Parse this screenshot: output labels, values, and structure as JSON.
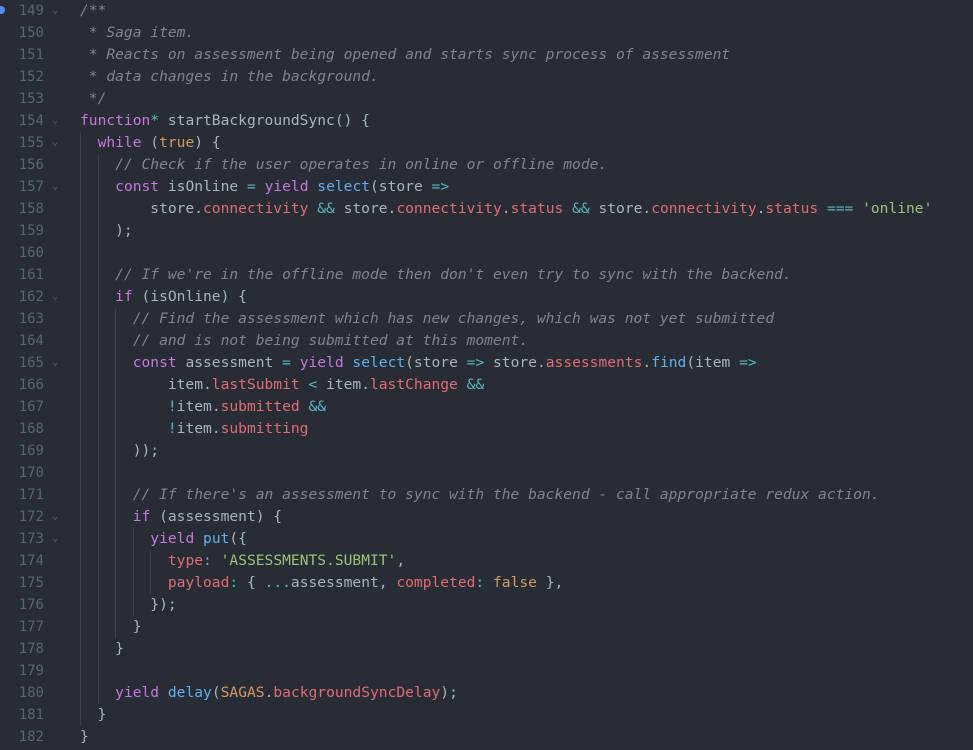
{
  "editor": {
    "breakpoint_line": 149,
    "lines": [
      {
        "n": "149",
        "fold": true,
        "indent": 0,
        "tokens": [
          [
            "c",
            "/**"
          ]
        ]
      },
      {
        "n": "150",
        "fold": false,
        "indent": 0,
        "tokens": [
          [
            "c",
            " * Saga item."
          ]
        ]
      },
      {
        "n": "151",
        "fold": false,
        "indent": 0,
        "tokens": [
          [
            "c",
            " * Reacts on assessment being opened and starts sync process of assessment"
          ]
        ]
      },
      {
        "n": "152",
        "fold": false,
        "indent": 0,
        "tokens": [
          [
            "c",
            " * data changes in the background."
          ]
        ]
      },
      {
        "n": "153",
        "fold": false,
        "indent": 0,
        "tokens": [
          [
            "c",
            " */"
          ]
        ]
      },
      {
        "n": "154",
        "fold": true,
        "indent": 0,
        "tokens": [
          [
            "k",
            "function"
          ],
          [
            "o",
            "*"
          ],
          [
            "p",
            " startBackgroundSync() {"
          ]
        ]
      },
      {
        "n": "155",
        "fold": true,
        "indent": 1,
        "tokens": [
          [
            "p",
            "  "
          ],
          [
            "k",
            "while"
          ],
          [
            "p",
            " ("
          ],
          [
            "n",
            "true"
          ],
          [
            "p",
            ") {"
          ]
        ]
      },
      {
        "n": "156",
        "fold": false,
        "indent": 2,
        "tokens": [
          [
            "p",
            "    "
          ],
          [
            "c",
            "// Check if the user operates in online or offline mode."
          ]
        ]
      },
      {
        "n": "157",
        "fold": true,
        "indent": 2,
        "tokens": [
          [
            "p",
            "    "
          ],
          [
            "k",
            "const"
          ],
          [
            "p",
            " isOnline "
          ],
          [
            "o",
            "="
          ],
          [
            "p",
            " "
          ],
          [
            "k",
            "yield"
          ],
          [
            "p",
            " "
          ],
          [
            "f",
            "select"
          ],
          [
            "p",
            "(store "
          ],
          [
            "o",
            "=>"
          ]
        ]
      },
      {
        "n": "158",
        "fold": false,
        "indent": 2,
        "tokens": [
          [
            "p",
            "        store."
          ],
          [
            "r",
            "connectivity"
          ],
          [
            "p",
            " "
          ],
          [
            "o",
            "&&"
          ],
          [
            "p",
            " store."
          ],
          [
            "r",
            "connectivity"
          ],
          [
            "p",
            "."
          ],
          [
            "r",
            "status"
          ],
          [
            "p",
            " "
          ],
          [
            "o",
            "&&"
          ],
          [
            "p",
            " store."
          ],
          [
            "r",
            "connectivity"
          ],
          [
            "p",
            "."
          ],
          [
            "r",
            "status"
          ],
          [
            "p",
            " "
          ],
          [
            "o",
            "==="
          ],
          [
            "p",
            " "
          ],
          [
            "s",
            "'online'"
          ]
        ]
      },
      {
        "n": "159",
        "fold": false,
        "indent": 2,
        "tokens": [
          [
            "p",
            "    );"
          ]
        ]
      },
      {
        "n": "160",
        "fold": false,
        "indent": 2,
        "tokens": []
      },
      {
        "n": "161",
        "fold": false,
        "indent": 2,
        "tokens": [
          [
            "p",
            "    "
          ],
          [
            "c",
            "// If we're in the offline mode then don't even try to sync with the backend."
          ]
        ]
      },
      {
        "n": "162",
        "fold": true,
        "indent": 2,
        "tokens": [
          [
            "p",
            "    "
          ],
          [
            "k",
            "if"
          ],
          [
            "p",
            " (isOnline) {"
          ]
        ]
      },
      {
        "n": "163",
        "fold": false,
        "indent": 3,
        "tokens": [
          [
            "p",
            "      "
          ],
          [
            "c",
            "// Find the assessment which has new changes, which was not yet submitted"
          ]
        ]
      },
      {
        "n": "164",
        "fold": false,
        "indent": 3,
        "tokens": [
          [
            "p",
            "      "
          ],
          [
            "c",
            "// and is not being submitted at this moment."
          ]
        ]
      },
      {
        "n": "165",
        "fold": true,
        "indent": 3,
        "tokens": [
          [
            "p",
            "      "
          ],
          [
            "k",
            "const"
          ],
          [
            "p",
            " assessment "
          ],
          [
            "o",
            "="
          ],
          [
            "p",
            " "
          ],
          [
            "k",
            "yield"
          ],
          [
            "p",
            " "
          ],
          [
            "f",
            "select"
          ],
          [
            "p",
            "(store "
          ],
          [
            "o",
            "=>"
          ],
          [
            "p",
            " store."
          ],
          [
            "r",
            "assessments"
          ],
          [
            "p",
            "."
          ],
          [
            "f",
            "find"
          ],
          [
            "p",
            "(item "
          ],
          [
            "o",
            "=>"
          ]
        ]
      },
      {
        "n": "166",
        "fold": false,
        "indent": 3,
        "tokens": [
          [
            "p",
            "          item."
          ],
          [
            "r",
            "lastSubmit"
          ],
          [
            "p",
            " "
          ],
          [
            "o",
            "<"
          ],
          [
            "p",
            " item."
          ],
          [
            "r",
            "lastChange"
          ],
          [
            "p",
            " "
          ],
          [
            "o",
            "&&"
          ]
        ]
      },
      {
        "n": "167",
        "fold": false,
        "indent": 3,
        "tokens": [
          [
            "p",
            "          "
          ],
          [
            "o",
            "!"
          ],
          [
            "p",
            "item."
          ],
          [
            "r",
            "submitted"
          ],
          [
            "p",
            " "
          ],
          [
            "o",
            "&&"
          ]
        ]
      },
      {
        "n": "168",
        "fold": false,
        "indent": 3,
        "tokens": [
          [
            "p",
            "          "
          ],
          [
            "o",
            "!"
          ],
          [
            "p",
            "item."
          ],
          [
            "r",
            "submitting"
          ]
        ]
      },
      {
        "n": "169",
        "fold": false,
        "indent": 3,
        "tokens": [
          [
            "p",
            "      ));"
          ]
        ]
      },
      {
        "n": "170",
        "fold": false,
        "indent": 3,
        "tokens": []
      },
      {
        "n": "171",
        "fold": false,
        "indent": 3,
        "tokens": [
          [
            "p",
            "      "
          ],
          [
            "c",
            "// If there's an assessment to sync with the backend - call appropriate redux action."
          ]
        ]
      },
      {
        "n": "172",
        "fold": true,
        "indent": 3,
        "tokens": [
          [
            "p",
            "      "
          ],
          [
            "k",
            "if"
          ],
          [
            "p",
            " (assessment) {"
          ]
        ]
      },
      {
        "n": "173",
        "fold": true,
        "indent": 4,
        "tokens": [
          [
            "p",
            "        "
          ],
          [
            "k",
            "yield"
          ],
          [
            "p",
            " "
          ],
          [
            "f",
            "put"
          ],
          [
            "p",
            "({"
          ]
        ]
      },
      {
        "n": "174",
        "fold": false,
        "indent": 5,
        "tokens": [
          [
            "p",
            "          "
          ],
          [
            "r",
            "type"
          ],
          [
            "o",
            ":"
          ],
          [
            "p",
            " "
          ],
          [
            "s",
            "'ASSESSMENTS.SUBMIT'"
          ],
          [
            "p",
            ","
          ]
        ]
      },
      {
        "n": "175",
        "fold": false,
        "indent": 5,
        "tokens": [
          [
            "p",
            "          "
          ],
          [
            "r",
            "payload"
          ],
          [
            "o",
            ":"
          ],
          [
            "p",
            " { "
          ],
          [
            "o",
            "..."
          ],
          [
            "p",
            "assessment, "
          ],
          [
            "r",
            "completed"
          ],
          [
            "o",
            ":"
          ],
          [
            "p",
            " "
          ],
          [
            "n",
            "false"
          ],
          [
            "p",
            " },"
          ]
        ]
      },
      {
        "n": "176",
        "fold": false,
        "indent": 4,
        "tokens": [
          [
            "p",
            "        });"
          ]
        ]
      },
      {
        "n": "177",
        "fold": false,
        "indent": 3,
        "tokens": [
          [
            "p",
            "      }"
          ]
        ]
      },
      {
        "n": "178",
        "fold": false,
        "indent": 2,
        "tokens": [
          [
            "p",
            "    }"
          ]
        ]
      },
      {
        "n": "179",
        "fold": false,
        "indent": 2,
        "tokens": []
      },
      {
        "n": "180",
        "fold": false,
        "indent": 2,
        "tokens": [
          [
            "p",
            "    "
          ],
          [
            "k",
            "yield"
          ],
          [
            "p",
            " "
          ],
          [
            "f",
            "delay"
          ],
          [
            "p",
            "("
          ],
          [
            "n",
            "SAGAS"
          ],
          [
            "p",
            "."
          ],
          [
            "r",
            "backgroundSyncDelay"
          ],
          [
            "p",
            ");"
          ]
        ]
      },
      {
        "n": "181",
        "fold": false,
        "indent": 1,
        "tokens": [
          [
            "p",
            "  }"
          ]
        ]
      },
      {
        "n": "182",
        "fold": false,
        "indent": 0,
        "tokens": [
          [
            "p",
            "}"
          ]
        ]
      }
    ]
  },
  "colors": {
    "background": "#282c34",
    "comment": "#7f848e",
    "keyword": "#c678dd",
    "function": "#61afef",
    "property": "#e06c75",
    "operator": "#56b6c2",
    "constant": "#d19a66",
    "string": "#98c379",
    "plain": "#abb2bf",
    "line_number": "#5c6370",
    "breakpoint": "#528bff"
  }
}
